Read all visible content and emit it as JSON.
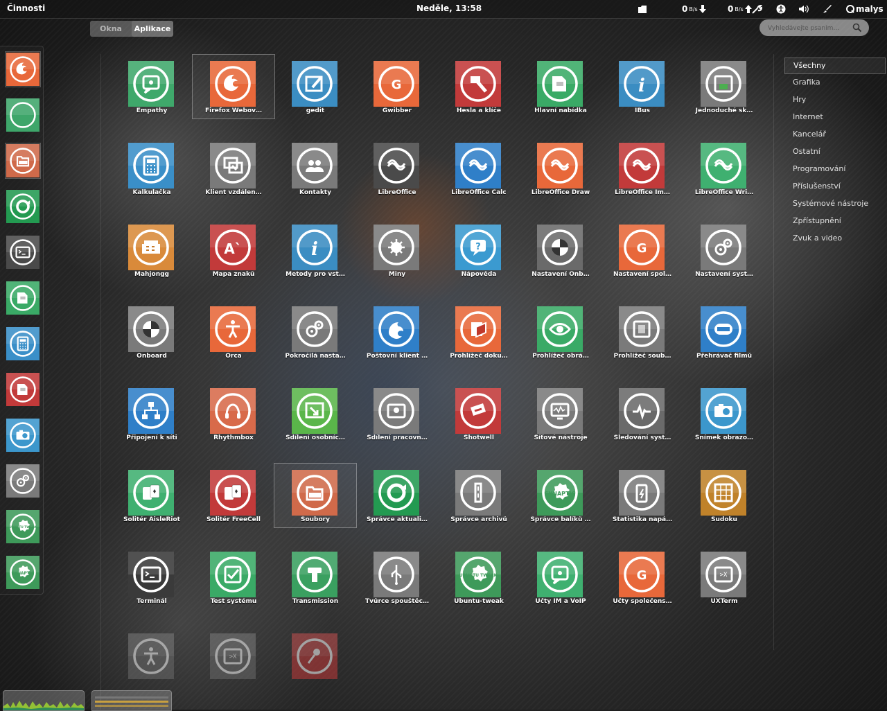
{
  "panel": {
    "activities": "Činnosti",
    "clock": "Neděle, 13:58",
    "net_down_value": "0",
    "net_down_unit": "B/s",
    "net_up_value": "0",
    "net_up_unit": "B/s",
    "user": "malys",
    "tray_icons": [
      "folder-icon",
      "arrow-down-icon",
      "arrow-up-icon",
      "wrench-icon",
      "accessibility-icon",
      "volume-icon",
      "brush-icon",
      "user-icon"
    ]
  },
  "view_selector": {
    "windows": "Okna",
    "applications": "Aplikace"
  },
  "search": {
    "placeholder": "Vyhledávejte psaním…"
  },
  "dash": [
    {
      "name": "firefox",
      "color": "#e8683a",
      "glyph": "fox",
      "running": true
    },
    {
      "name": "gwibber",
      "color": "#3ea66a",
      "glyph": "leaf",
      "running": false
    },
    {
      "name": "soubory",
      "color": "#d06a4a",
      "glyph": "folder",
      "running": true
    },
    {
      "name": "spravce-aktualizaci",
      "color": "#239a51",
      "glyph": "ring",
      "running": false
    },
    {
      "name": "terminal",
      "color": "#4a4a4a",
      "glyph": "terminal",
      "running": false
    },
    {
      "name": "hlavni-nabidka",
      "color": "#3aaa66",
      "glyph": "doc",
      "running": false
    },
    {
      "name": "kalkulacka",
      "color": "#3a8fc8",
      "glyph": "calc",
      "running": false
    },
    {
      "name": "hesla",
      "color": "#c23a3a",
      "glyph": "doc",
      "running": false
    },
    {
      "name": "snimek",
      "color": "#3c97cc",
      "glyph": "camera",
      "running": false
    },
    {
      "name": "nastaveni",
      "color": "#7a7a7a",
      "glyph": "gears",
      "running": false
    },
    {
      "name": "ubuntu-tweak",
      "color": "#3e9a5a",
      "glyph": "tweak",
      "running": false
    },
    {
      "name": "synaptic",
      "color": "#3e9a5a",
      "glyph": "synaptic",
      "running": false
    }
  ],
  "apps": [
    {
      "label": "Empathy",
      "color": "#3fa86b",
      "glyph": "chat"
    },
    {
      "label": "Firefox Webov…",
      "color": "#e8683a",
      "glyph": "fox",
      "selected": true
    },
    {
      "label": "gedit",
      "color": "#3b8dc2",
      "glyph": "edit"
    },
    {
      "label": "Gwibber",
      "color": "#e8683a",
      "glyph": "g"
    },
    {
      "label": "Hesla a klíče",
      "color": "#c23a3a",
      "glyph": "key"
    },
    {
      "label": "Hlavní nabídka",
      "color": "#3aaa66",
      "glyph": "doc"
    },
    {
      "label": "IBus",
      "color": "#3b8dc2",
      "glyph": "info"
    },
    {
      "label": "Jednoduché sk…",
      "color": "#7a7a7a",
      "glyph": "scanner"
    },
    {
      "label": "Kalkulačka",
      "color": "#3a8fc8",
      "glyph": "calc"
    },
    {
      "label": "Klient vzdálen…",
      "color": "#7a7a7a",
      "glyph": "remote"
    },
    {
      "label": "Kontakty",
      "color": "#7a7a7a",
      "glyph": "people"
    },
    {
      "label": "LibreOffice",
      "color": "#4a4a4a",
      "glyph": "lo"
    },
    {
      "label": "LibreOffice Calc",
      "color": "#2f7fc8",
      "glyph": "lo"
    },
    {
      "label": "LibreOffice Draw",
      "color": "#e8683a",
      "glyph": "lo"
    },
    {
      "label": "LibreOffice Im…",
      "color": "#c23a3a",
      "glyph": "lo"
    },
    {
      "label": "LibreOffice Wri…",
      "color": "#3fb070",
      "glyph": "lo"
    },
    {
      "label": "Mahjongg",
      "color": "#d98a3a",
      "glyph": "mahjong"
    },
    {
      "label": "Mapa znaků",
      "color": "#c23a3a",
      "glyph": "charmap"
    },
    {
      "label": "Metody pro vst…",
      "color": "#3b8dc2",
      "glyph": "info"
    },
    {
      "label": "Miny",
      "color": "#7a7a7a",
      "glyph": "mine"
    },
    {
      "label": "Nápověda",
      "color": "#3b9ad0",
      "glyph": "help"
    },
    {
      "label": "Nastavení Onb…",
      "color": "#6a6a6a",
      "glyph": "onboard"
    },
    {
      "label": "Nastavení spol…",
      "color": "#e8683a",
      "glyph": "g"
    },
    {
      "label": "Nastavení syst…",
      "color": "#7a7a7a",
      "glyph": "gears"
    },
    {
      "label": "Onboard",
      "color": "#7a7a7a",
      "glyph": "onboard"
    },
    {
      "label": "Orca",
      "color": "#e8683a",
      "glyph": "person"
    },
    {
      "label": "Pokročilá nasta…",
      "color": "#7a7a7a",
      "glyph": "gears"
    },
    {
      "label": "Poštovní klient …",
      "color": "#2f7fc8",
      "glyph": "mail"
    },
    {
      "label": "Prohlížeč doku…",
      "color": "#e8683a",
      "glyph": "docview"
    },
    {
      "label": "Prohlížeč obrá…",
      "color": "#3aaa66",
      "glyph": "eye"
    },
    {
      "label": "Prohlížeč soub…",
      "color": "#7a7a7a",
      "glyph": "file"
    },
    {
      "label": "Přehrávač filmů",
      "color": "#2f7fc8",
      "glyph": "film"
    },
    {
      "label": "Připojení k síti",
      "color": "#2f7fc8",
      "glyph": "network"
    },
    {
      "label": "Rhythmbox",
      "color": "#d86a4a",
      "glyph": "music"
    },
    {
      "label": "Sdílení osobníc…",
      "color": "#5ab64a",
      "glyph": "share"
    },
    {
      "label": "Sdílení pracovn…",
      "color": "#7a7a7a",
      "glyph": "desk"
    },
    {
      "label": "Shotwell",
      "color": "#c23a3a",
      "glyph": "photo"
    },
    {
      "label": "Síťové nástroje",
      "color": "#7a7a7a",
      "glyph": "monitor"
    },
    {
      "label": "Sledování syst…",
      "color": "#6a6a6a",
      "glyph": "pulse"
    },
    {
      "label": "Snímek obrazo…",
      "color": "#3c97cc",
      "glyph": "camera"
    },
    {
      "label": "Solitér AisleRiot",
      "color": "#3fb070",
      "glyph": "cards"
    },
    {
      "label": "Solitér FreeCell",
      "color": "#c23a3a",
      "glyph": "cards"
    },
    {
      "label": "Soubory",
      "color": "#d06a4a",
      "glyph": "folder",
      "selected": true
    },
    {
      "label": "Správce aktuali…",
      "color": "#239a51",
      "glyph": "ring"
    },
    {
      "label": "Správce archivů",
      "color": "#7a7a7a",
      "glyph": "zip"
    },
    {
      "label": "Správce balíků …",
      "color": "#3e9a5a",
      "glyph": "synaptic"
    },
    {
      "label": "Statistika napá…",
      "color": "#7a7a7a",
      "glyph": "battery"
    },
    {
      "label": "Sudoku",
      "color": "#c0822a",
      "glyph": "sudoku"
    },
    {
      "label": "Terminál",
      "color": "#3a3a3a",
      "glyph": "terminal"
    },
    {
      "label": "Test systému",
      "color": "#3aaa66",
      "glyph": "check"
    },
    {
      "label": "Transmission",
      "color": "#3aa060",
      "glyph": "transmission"
    },
    {
      "label": "Tvůrce spouštěc…",
      "color": "#7a7a7a",
      "glyph": "usb"
    },
    {
      "label": "Ubuntu-tweak",
      "color": "#3e9a5a",
      "glyph": "tweak"
    },
    {
      "label": "Účty IM a VoIP",
      "color": "#3fb070",
      "glyph": "chat"
    },
    {
      "label": "Účty společens…",
      "color": "#e8683a",
      "glyph": "g"
    },
    {
      "label": "UXTerm",
      "color": "#7a7a7a",
      "glyph": "xterm"
    },
    {
      "label": "",
      "color": "#6a6a6a",
      "glyph": "person",
      "fade": true
    },
    {
      "label": "",
      "color": "#6a6a6a",
      "glyph": "xterm",
      "fade": true
    },
    {
      "label": "",
      "color": "#c23a3a",
      "glyph": "mic",
      "fade": true
    }
  ],
  "categories": [
    "Všechny",
    "Grafika",
    "Hry",
    "Internet",
    "Kancelář",
    "Ostatní",
    "Programování",
    "Příslušenství",
    "Systémové nástroje",
    "Zpřístupnění",
    "Zvuk a video"
  ],
  "active_category": 0
}
